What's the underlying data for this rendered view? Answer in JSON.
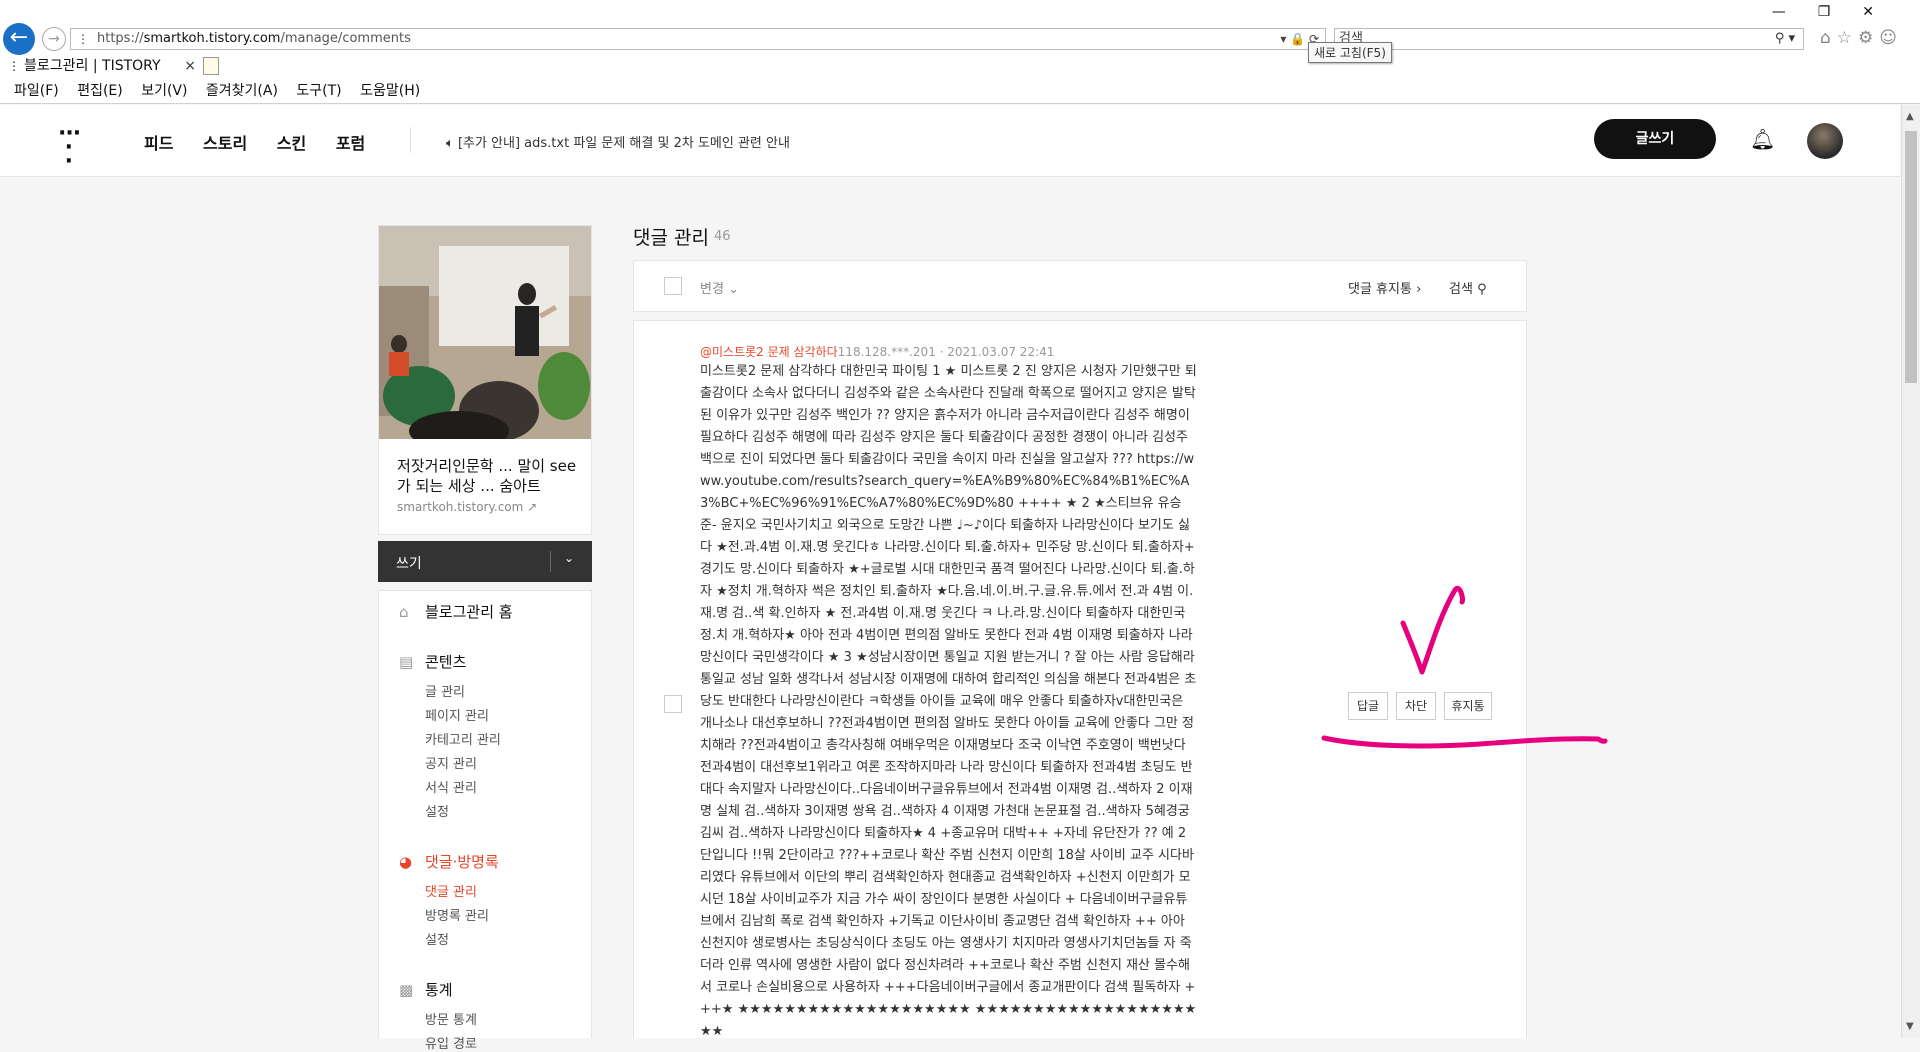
{
  "browser": {
    "url_prefix": "https://",
    "url_host": "smartkoh.tistory.com",
    "url_path": "/manage/comments",
    "search_placeholder": "검색",
    "tooltip": "새로 고침(F5)",
    "tab_title": "블로그관리 | TISTORY",
    "menu": [
      "파일(F)",
      "편집(E)",
      "보기(V)",
      "즐겨찾기(A)",
      "도구(T)",
      "도움말(H)"
    ]
  },
  "header": {
    "nav": [
      "피드",
      "스토리",
      "스킨",
      "포럼"
    ],
    "notice": "[추가 안내] ads.txt 파일 문제 해결 및 2차 도메인 관련 안내",
    "write_label": "글쓰기"
  },
  "sidebar": {
    "blog_title": "저잣거리인문학 ... 말이 see가 되는 세상 ... 숨아트",
    "blog_url": "smartkoh.tistory.com",
    "write_label": "쓰기",
    "home": "블로그관리 홈",
    "contents": {
      "title": "콘텐츠",
      "items": [
        "글 관리",
        "페이지 관리",
        "카테고리 관리",
        "공지 관리",
        "서식 관리",
        "설정"
      ]
    },
    "comments": {
      "title": "댓글·방명록",
      "items": [
        "댓글 관리",
        "방명록 관리",
        "설정"
      ]
    },
    "stats": {
      "title": "통계",
      "items": [
        "방문 통계",
        "유입 경로"
      ]
    }
  },
  "main": {
    "title": "댓글 관리",
    "count": "46",
    "change_label": "변경",
    "trash_label": "댓글 휴지통",
    "search_label": "검색",
    "comment": {
      "author": "@미스트롯2 문제 삼각하다",
      "ip": "118.128.***.201",
      "date": "2021.03.07 22:41",
      "text": "미스트롯2 문제 삼각하다 대한민국 파이팅 1 ★ 미스트롯 2 진 양지은 시청자 기만했구만 퇴출감이다 소속사 없다더니 김성주와 같은 소속사란다 진달래 학폭으로 떨어지고 양지은 발탁된 이유가 있구만 김성주 백인가 ?? 양지은 흙수저가 아니라 금수저급이란다 김성주 해명이 필요하다 김성주 해명에 따라 김성주 양지은 둘다 퇴출감이다 공정한 경쟁이 아니라 김성주 백으로 진이 되었다면 둘다 퇴출감이다 국민을 속이지 마라 진실을 알고살자 ??? https://www.youtube.com/results?search_query=%EA%B9%80%EC%84%B1%EC%A3%BC+%EC%96%91%EC%A7%80%EC%9D%80 ++++ ★ 2 ★스티브유 유승준- 윤지오 국민사기치고 외국으로 도망간 나쁜 ♩~♪이다 퇴출하자 나라망신이다 보기도 싫다 ★전.과.4범 이.재.명 웃긴다ㅎ 나라망.신이다 퇴.출.하자+ 민주당 망.신이다 퇴.출하자+ 경기도 망.신이다 퇴출하자 ★+글로벌 시대 대한민국 품격 떨어진다 나라망.신이다 퇴.출.하자 ★정치 개.혁하자 썩은 정치인 퇴.출하자 ★다.음.네.이.버.구.글.유.튜.에서 전.과 4범 이.재.명 검..색 확.인하자 ★ 전.과4범 이.재.명 웃긴다 ㅋ 나.라.망.신이다 퇴출하자 대한민국 정.치 개.혁하자★ 아아 전과 4범이면 편의점 알바도 못한다 전과 4범 이재명 퇴출하자 나라망신이다 국민생각이다 ★ 3 ★성남시장이면 통일교 지원 받는거니 ? 잘 아는 사람 응답해라 통일교 성남 일화 생각나서 성남시장 이재명에 대하여 합리적인 의심을 해본다 전과4범은 초당도 반대한다 나라망신이란다 ㅋ학생들 아이들 교육에 매우 안좋다 퇴출하자v대한민국은 개나소나 대선후보하니 ??전과4범이면 편의점 알바도 못한다 아이들 교육에 안좋다 그만 정치해라 ??전과4범이고 총각사칭해 여배우먹은 이재명보다 조국 이낙연 주호영이 백번낫다 전과4범이 대선후보1위라고 여론 조작하지마라 나라 망신이다 퇴출하자 전과4범 초딩도 반대다 속지말자 나라망신이다..다음네이버구글유튜브에서 전과4범 이재명 검..색하자 2 이재명 실체 검..색하자 3이재명 쌍욕 검..색하자 4 이재명 가천대 논문표절 검..색하자 5혜경궁김씨 검..색하자 나라망신이다 퇴출하자★ 4 +종교유머 대박++ +자네 유단잔가 ?? 예 2단입니다 !!뭐 2단이라고 ???++코로나 확산 주범 신천지 이만희 18살 사이비 교주 시다바리였다 유튜브에서 이단의 뿌리 검색확인하자 현대종교 검색확인하자 +신천지 이만희가 모시던 18살 사이비교주가 지금 가수 싸이 장인이다 분명한 사실이다 + 다음네이버구글유튜브에서 김남희 폭로 검색 확인하자 +기독교 이단사이비 종교명단 검색 확인하자 ++ 아아 신천지야 생로병사는 초딩상식이다 초딩도 아는 영생사기 치지마라 영생사기치던놈들 자 죽더라 인류 역사에 영생한 사람이 없다 정신차려라 ++코로나 확산 주범 신천지 재산 몰수해서 코로나 손실비용으로 사용하자 +++다음네이버구글에서 종교개판이다 검색 필독하자 +++★ ★★★★★★★★★★★★★★★★★★★★ ★★★★★★★★★★★★★★★★★★★★★"
    },
    "actions": {
      "reply": "답글",
      "block": "차단",
      "trash": "휴지통"
    }
  },
  "colors": {
    "accent": "#e8462a",
    "annotation": "#e6007e",
    "header_btn": "#111111"
  }
}
